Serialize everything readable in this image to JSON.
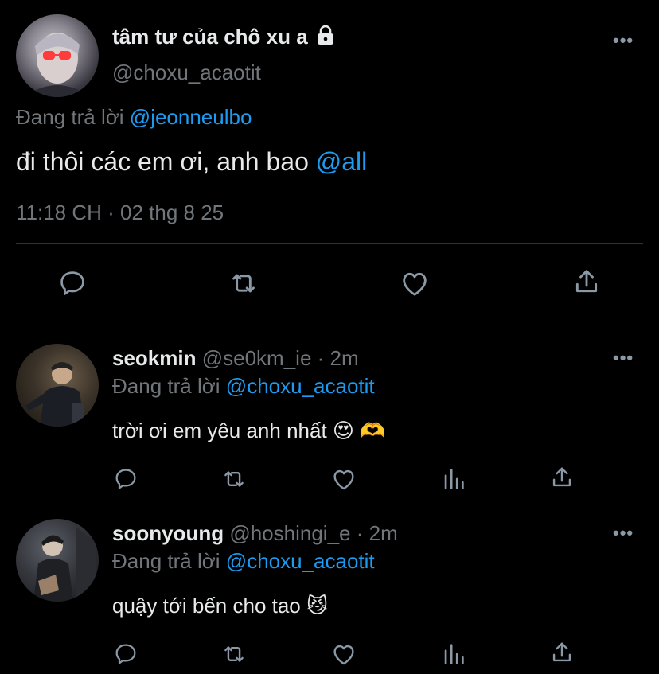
{
  "main_tweet": {
    "display_name": "tâm tư của chô xu a",
    "handle": "@choxu_acaotit",
    "reply_prefix": "Đang trả lời",
    "reply_to": "@jeonneulbo",
    "text": "đi thôi các em ơi, anh bao",
    "mention": "@all",
    "timestamp": "11:18 CH · 02 thg 8 25"
  },
  "replies": [
    {
      "display_name": "seokmin",
      "handle": "@se0km_ie",
      "time": "· 2m",
      "reply_prefix": "Đang trả lời",
      "reply_to": "@choxu_acaotit",
      "text": "trời ơi em yêu anh nhất 😍 🫶"
    },
    {
      "display_name": "soonyoung",
      "handle": "@hoshingi_e",
      "time": "· 2m",
      "reply_prefix": "Đang trả lời",
      "reply_to": "@choxu_acaotit",
      "text": "quậy tới bến cho tao 😼"
    }
  ],
  "more_glyph": "•••",
  "icons": [
    "reply-icon",
    "retweet-icon",
    "like-icon",
    "share-icon",
    "analytics-icon",
    "lock-icon"
  ],
  "colors": {
    "accent": "#1d9bf0",
    "muted": "#71767b",
    "background": "#000000",
    "divider": "#2f3336"
  }
}
